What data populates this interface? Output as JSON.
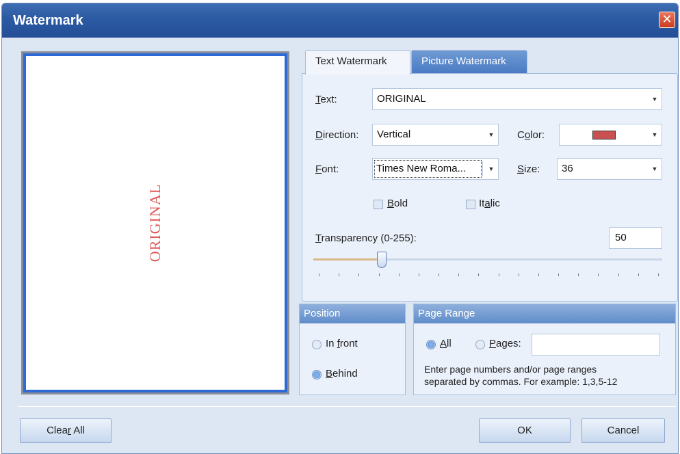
{
  "window": {
    "title": "Watermark",
    "close_glyph": "✕"
  },
  "preview": {
    "watermark_text": "ORIGINAL",
    "watermark_color": "#e05959"
  },
  "tabs": [
    {
      "label": "Text Watermark",
      "active": true
    },
    {
      "label": "Picture Watermark",
      "active": false
    }
  ],
  "text_watermark": {
    "text_label": "Text:",
    "text_value": "ORIGINAL",
    "direction_label": "Direction:",
    "direction_value": "Vertical",
    "color_label": "Color:",
    "color_value": "#c85050",
    "font_label": "Font:",
    "font_value": "Times New Roma...",
    "size_label": "Size:",
    "size_value": "36",
    "bold_label": "Bold",
    "bold_checked": false,
    "italic_label": "Italic",
    "italic_checked": false,
    "transparency_label": "Transparency (0-255):",
    "transparency_value": "50",
    "transparency_max": 255
  },
  "position": {
    "header": "Position",
    "in_front_label": "In front",
    "behind_label": "Behind",
    "selected": "Behind"
  },
  "page_range": {
    "header": "Page Range",
    "all_label": "All",
    "pages_label": "Pages:",
    "pages_value": "",
    "selected": "All",
    "hint_line1": "Enter page numbers and/or page ranges",
    "hint_line2": "separated by commas. For example: 1,3,5-12"
  },
  "buttons": {
    "clear_all": "Clear All",
    "ok": "OK",
    "cancel": "Cancel"
  }
}
